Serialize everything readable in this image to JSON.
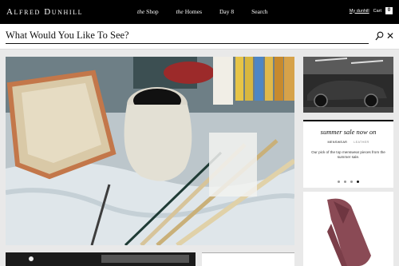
{
  "header": {
    "brand": "Alfred Dunhill",
    "nav": [
      {
        "prefix": "the",
        "label": "Shop"
      },
      {
        "prefix": "the",
        "label": "Homes"
      },
      {
        "prefix": "",
        "label": "Day 8"
      },
      {
        "prefix": "",
        "label": "Search"
      }
    ],
    "account_label": "My dunhill",
    "cart_label": "Cart",
    "cart_count": "0"
  },
  "search": {
    "placeholder": "What Would You Like To See?"
  },
  "promo": {
    "title": "summer sale now on",
    "tabs": [
      {
        "label": "MENSWEAR",
        "active": true
      },
      {
        "label": "LEATHER",
        "active": false
      }
    ],
    "description": "Our pick of the top menswear pieces from the summer sale.",
    "carousel": {
      "slides": 4,
      "active": 4
    }
  },
  "icons": [
    "search-icon",
    "close-icon",
    "cart-icon"
  ]
}
